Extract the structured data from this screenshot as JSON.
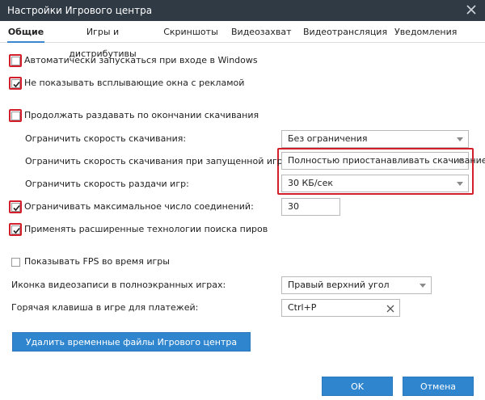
{
  "window": {
    "title": "Настройки Игрового центра"
  },
  "tabs": [
    {
      "label": "Общие",
      "active": true
    },
    {
      "label": "Игры и дистрибутивы"
    },
    {
      "label": "Скриншоты"
    },
    {
      "label": "Видеозахват"
    },
    {
      "label": "Видеотрансляция"
    },
    {
      "label": "Уведомления"
    }
  ],
  "settings": {
    "autostart": {
      "label": "Автоматически запускаться при входе в Windows",
      "checked": false
    },
    "no_ads": {
      "label": "Не показывать всплывающие окна с рекламой",
      "checked": true
    },
    "keep_seeding": {
      "label": "Продолжать раздавать по окончании скачивания",
      "checked": false
    },
    "limit_download": {
      "label": "Ограничить скорость скачивания:",
      "value": "Без ограничения"
    },
    "limit_download_game": {
      "label": "Ограничить скорость скачивания при запущенной игре:",
      "value": "Полностью приостанавливать скачивание"
    },
    "limit_upload_game": {
      "label": "Ограничить скорость раздачи игр:",
      "value": "30 КБ/сек"
    },
    "max_connections": {
      "label": "Ограничивать максимальное число соединений:",
      "checked": true,
      "value": "30"
    },
    "peer_search": {
      "label": "Применять расширенные технологии поиска пиров",
      "checked": true
    },
    "show_fps": {
      "label": "Показывать FPS во время игры",
      "checked": false
    },
    "video_icon": {
      "label": "Иконка видеозаписи в полноэкранных играх:",
      "value": "Правый верхний угол"
    },
    "payment_hotkey": {
      "label": "Горячая клавиша в игре для платежей:",
      "value": "Ctrl+P"
    }
  },
  "buttons": {
    "delete_temp": "Удалить временные файлы Игрового центра",
    "ok": "OK",
    "cancel": "Отмена"
  },
  "colors": {
    "titlebar": "#2f3a45",
    "accent": "#2f86cf",
    "highlight": "#d21f2b"
  }
}
